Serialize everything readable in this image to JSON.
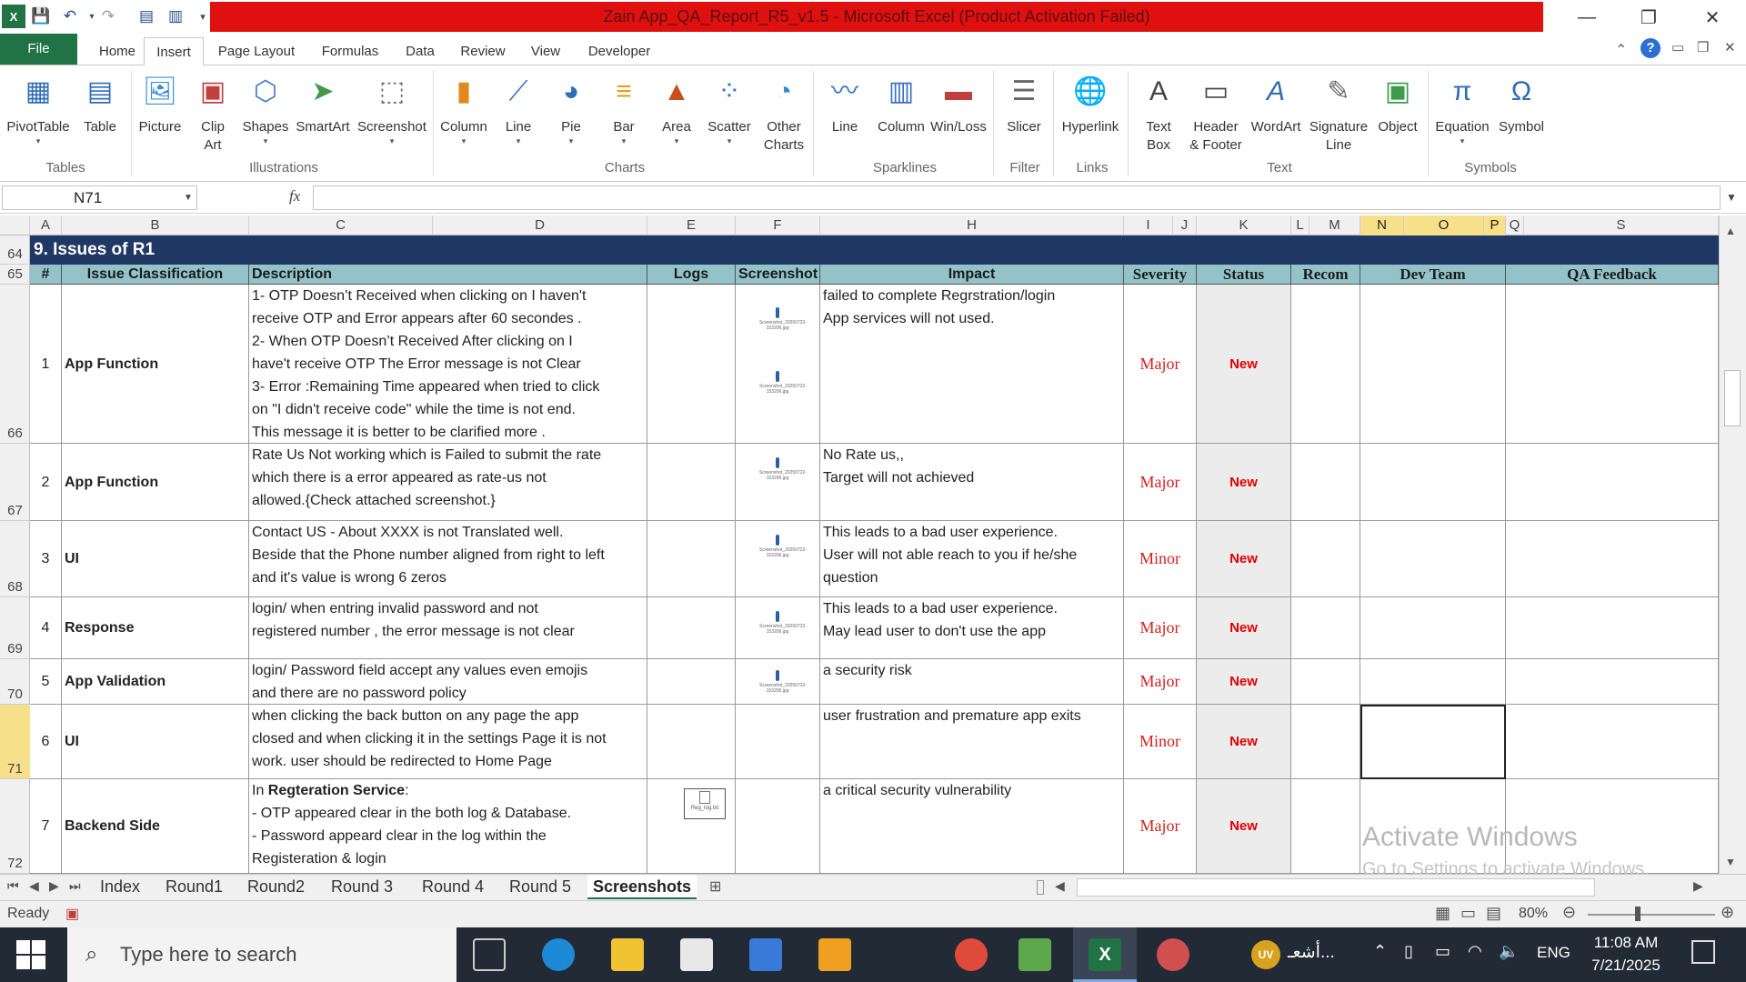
{
  "window": {
    "title": "Zain App_QA_Report_R5_v1.5 - Microsoft Excel (Product Activation Failed)",
    "minimize": "—",
    "restore": "❐",
    "close": "✕"
  },
  "ribbon_tabs": [
    "File",
    "Home",
    "Insert",
    "Page Layout",
    "Formulas",
    "Data",
    "Review",
    "View",
    "Developer"
  ],
  "ribbon": {
    "pivottable": "PivotTable",
    "table": "Table",
    "picture": "Picture",
    "clipart_1": "Clip",
    "clipart_2": "Art",
    "shapes": "Shapes",
    "smartart": "SmartArt",
    "screenshot": "Screenshot",
    "column": "Column",
    "line": "Line",
    "pie": "Pie",
    "bar": "Bar",
    "area": "Area",
    "scatter": "Scatter",
    "othercharts_1": "Other",
    "othercharts_2": "Charts",
    "spark_line": "Line",
    "spark_column": "Column",
    "winloss": "Win/Loss",
    "slicer": "Slicer",
    "hyperlink": "Hyperlink",
    "textbox_1": "Text",
    "textbox_2": "Box",
    "header_1": "Header",
    "header_2": "& Footer",
    "wordart": "WordArt",
    "signature_1": "Signature",
    "signature_2": "Line",
    "object": "Object",
    "equation": "Equation",
    "symbol": "Symbol",
    "groups": {
      "tables": "Tables",
      "illustrations": "Illustrations",
      "charts": "Charts",
      "sparklines": "Sparklines",
      "filter": "Filter",
      "links": "Links",
      "text": "Text",
      "symbols": "Symbols"
    }
  },
  "formula_bar": {
    "name_box": "N71",
    "fx": "fx",
    "formula": ""
  },
  "columns": [
    "A",
    "B",
    "C",
    "D",
    "E",
    "F",
    "H",
    "I",
    "J",
    "K",
    "L",
    "M",
    "N",
    "O",
    "P",
    "Q",
    "S"
  ],
  "row_numbers": [
    "64",
    "65",
    "66",
    "67",
    "68",
    "69",
    "70",
    "71",
    "72"
  ],
  "section_title": "9.  Issues of R1",
  "headers": {
    "num": "#",
    "classification": "Issue Classification",
    "description": "Description",
    "logs": "Logs",
    "screenshot": "Screenshot",
    "impact": "Impact",
    "severity": "Severity",
    "status": "Status",
    "recom": "Recom",
    "dev_team": "Dev Team",
    "qa_feedback": "QA Feedback"
  },
  "issues": [
    {
      "num": "1",
      "classification": "App Function",
      "description": [
        "1- OTP Doesn’t Received  when clicking on I haven't",
        "receive OTP and Error appears after 60 secondes .",
        "2- When OTP Doesn’t Received  After clicking on I",
        "have't receive OTP The Error message is not Clear",
        "3- Error :Remaining Time appeared when tried to click",
        "on \"I didn't receive code\" while the time is not end.",
        "This message it is better to be clarified more ."
      ],
      "impact": [
        "failed to complete Regrstration/login",
        "App services will not used."
      ],
      "severity": "Major",
      "status": "New"
    },
    {
      "num": "2",
      "classification": "App Function",
      "description": [
        "Rate Us Not working which is Failed to submit the rate",
        "which there is a error appeared as rate-us not",
        "allowed.{Check attached screenshot.}"
      ],
      "impact": [
        "No Rate us,,",
        "Target will not achieved"
      ],
      "severity": "Major",
      "status": "New"
    },
    {
      "num": "3",
      "classification": "UI",
      "description": [
        "Contact US - About XXXX is  not Translated well.",
        "Beside that the Phone number aligned from right to left",
        "and it's value is wrong 6 zeros"
      ],
      "impact": [
        "This leads to a bad user experience.",
        "User will not able reach to you if he/she",
        "question"
      ],
      "severity": "Minor",
      "status": "New"
    },
    {
      "num": "4",
      "classification": "Response",
      "description": [
        "login/ when entring invalid password and not",
        "registered number , the error message is not clear"
      ],
      "impact": [
        "This leads to a bad user experience.",
        "May lead user to don't use the app"
      ],
      "severity": "Major",
      "status": "New"
    },
    {
      "num": "5",
      "classification": "App Validation",
      "description": [
        "login/ Password field accept any values even emojis",
        "and there are no  password policy"
      ],
      "impact": [
        " a security risk"
      ],
      "severity": "Major",
      "status": "New"
    },
    {
      "num": "6",
      "classification": "UI",
      "description": [
        "when clicking the back button on any page the app",
        "closed and when clicking it in the settings Page it is not",
        "work. user should be redirected to Home Page"
      ],
      "impact": [
        "user frustration and premature app exits"
      ],
      "severity": "Minor",
      "status": "New"
    },
    {
      "num": "7",
      "classification": "Backend  Side",
      "description": [
        "In Regteration Service:",
        "- OTP appeared clear in the both log & Database.",
        "- Password appeard clear in the log within the",
        "Registeration & login"
      ],
      "impact": [
        "a critical security vulnerability"
      ],
      "severity": "Major",
      "status": "New"
    }
  ],
  "screenshot_thumbs": {
    "t1": "Screenshot_20250722-153206.jpg",
    "t2": "Screenshot_20250722-153206.jpg",
    "t3": "Screenshot_20250722-153206.jpg",
    "t4": "Screenshot_20250722-153206.jpg",
    "t5": "Screenshot_20250722-153206.jpg",
    "t6": "Screenshot_20250722-153206.jpg",
    "log": "Reg_log.txt"
  },
  "sheet_tabs": [
    "Index",
    "Round1",
    "Round2",
    "Round 3",
    "Round 4",
    "Round 5",
    "Screenshots"
  ],
  "watermark": {
    "line1": "Activate Windows",
    "line2": "Go to Settings to activate Windows."
  },
  "status_bar": {
    "ready": "Ready",
    "zoom": "80%"
  },
  "taskbar": {
    "search": "Type here to search",
    "time": "11:08 AM",
    "date": "7/21/2025",
    "lang": "ENG",
    "user": "UV",
    "user_label": "أشعـ..."
  },
  "colors": {
    "excel_green": "#217346",
    "header_teal": "#93c3c8",
    "section_navy": "#1f3864",
    "severity_red": "#d42020"
  }
}
